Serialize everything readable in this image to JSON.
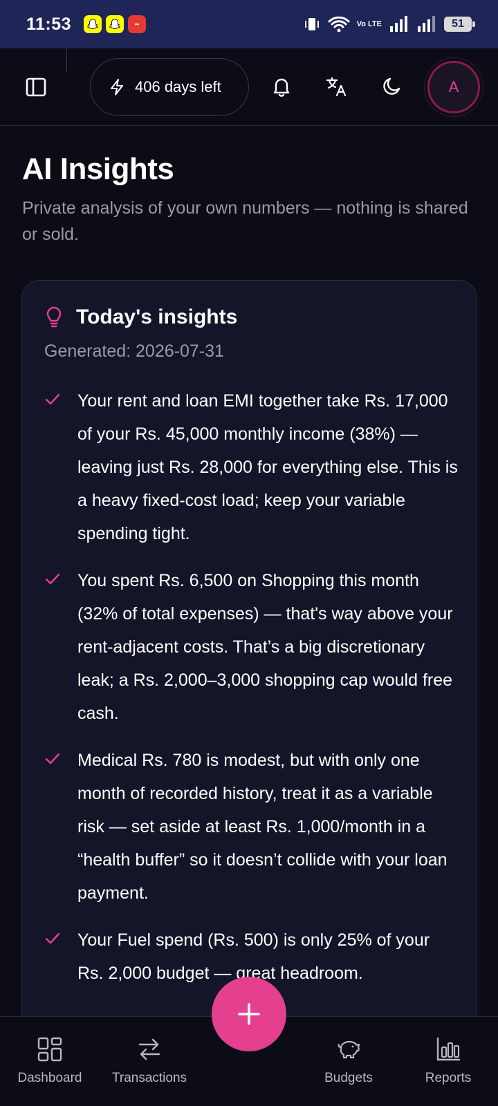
{
  "status_bar": {
    "time": "11:53",
    "battery": "51",
    "network_label": "Vo LTE"
  },
  "header": {
    "days_left": "406 days left",
    "avatar_initial": "A"
  },
  "page": {
    "title": "AI Insights",
    "subtitle": "Private analysis of your own numbers — nothing is shared or sold."
  },
  "card": {
    "title": "Today's insights",
    "generated": "Generated: 2026-07-31",
    "insights": [
      "Your rent and loan EMI together take Rs. 17,000 of your Rs. 45,000 monthly income (38%) — leaving just Rs. 28,000 for everything else. This is a heavy fixed-cost load; keep your variable spending tight.",
      "You spent Rs. 6,500 on Shopping this month (32% of total expenses) — that's way above your rent-adjacent costs. That’s a big discretionary leak; a Rs. 2,000–3,000 shopping cap would free cash.",
      "Medical Rs. 780 is modest, but with only one month of recorded history, treat it as a variable risk — set aside at least Rs. 1,000/month in a “health buffer” so it doesn’t collide with your loan payment.",
      "Your Fuel spend (Rs. 500) is only 25% of your Rs. 2,000 budget — great headroom."
    ]
  },
  "nav": {
    "dashboard": "Dashboard",
    "transactions": "Transactions",
    "budgets": "Budgets",
    "reports": "Reports"
  },
  "colors": {
    "accent": "#e4408f",
    "background": "#0c0c17",
    "card": "#15152a",
    "status_bar": "#1f2557"
  }
}
